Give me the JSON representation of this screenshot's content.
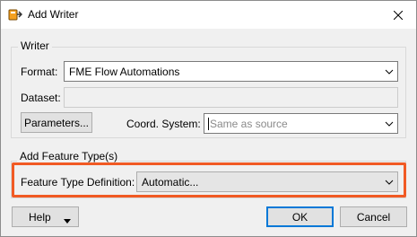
{
  "window": {
    "title": "Add Writer",
    "icon": "fme-writer-icon",
    "close_icon": "close-icon"
  },
  "writer_group": {
    "label": "Writer",
    "format_label": "Format:",
    "format_value": "FME Flow Automations",
    "dataset_label": "Dataset:",
    "dataset_value": "",
    "parameters_label": "Parameters...",
    "coord_label": "Coord. System:",
    "coord_placeholder": "Same as source"
  },
  "feature_group": {
    "label": "Add Feature Type(s)",
    "definition_label": "Feature Type Definition:",
    "definition_value": "Automatic..."
  },
  "footer": {
    "help_label": "Help",
    "ok_label": "OK",
    "cancel_label": "Cancel"
  },
  "colors": {
    "highlight": "#f15a24",
    "accent": "#0078d7",
    "dialog_bg": "#f0f0f0"
  }
}
